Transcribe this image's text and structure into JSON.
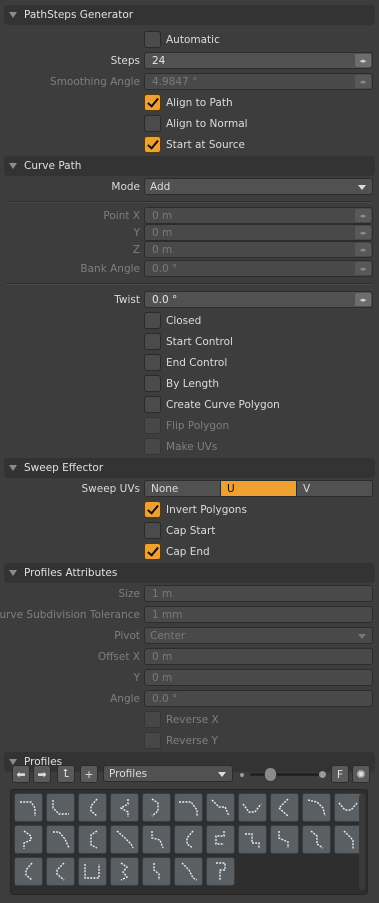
{
  "sections": {
    "pathsteps": "PathSteps Generator",
    "curve": "Curve Path",
    "sweep": "Sweep Effector",
    "profiles_attr": "Profiles Attributes",
    "profiles": "Profiles"
  },
  "pathsteps": {
    "automatic": "Automatic",
    "steps_label": "Steps",
    "steps_value": "24",
    "smoothing_label": "Smoothing Angle",
    "smoothing_value": "4.9847 °",
    "align_path": "Align to Path",
    "align_normal": "Align to Normal",
    "start_source": "Start at Source"
  },
  "curve": {
    "mode_label": "Mode",
    "mode_value": "Add",
    "px_label": "Point X",
    "px": "0 m",
    "y_label": "Y",
    "y": "0 m",
    "z_label": "Z",
    "z": "0 m",
    "bank_label": "Bank Angle",
    "bank": "0.0 °",
    "twist_label": "Twist",
    "twist": "0.0 °",
    "closed": "Closed",
    "start_control": "Start Control",
    "end_control": "End Control",
    "by_length": "By Length",
    "create_poly": "Create Curve Polygon",
    "flip_poly": "Flip Polygon",
    "make_uvs": "Make UVs"
  },
  "sweep": {
    "uvs_label": "Sweep UVs",
    "opt_none": "None",
    "opt_u": "U",
    "opt_v": "V",
    "invert": "Invert Polygons",
    "cap_start": "Cap Start",
    "cap_end": "Cap End"
  },
  "profattr": {
    "size_label": "Size",
    "size": "1 m",
    "tol_label": "Curve Subdivision Tolerance",
    "tol": "1 mm",
    "pivot_label": "Pivot",
    "pivot": "Center",
    "ox_label": "Offset X",
    "ox": "0 m",
    "oy_label": "Y",
    "oy": "0 m",
    "angle_label": "Angle",
    "angle": "0.0 °",
    "rev_x": "Reverse X",
    "rev_y": "Reverse Y"
  },
  "profiles": {
    "dropdown": "Profiles",
    "f_btn": "F"
  },
  "colors": {
    "accent": "#f0a030",
    "panel": "#3d3d3d"
  }
}
